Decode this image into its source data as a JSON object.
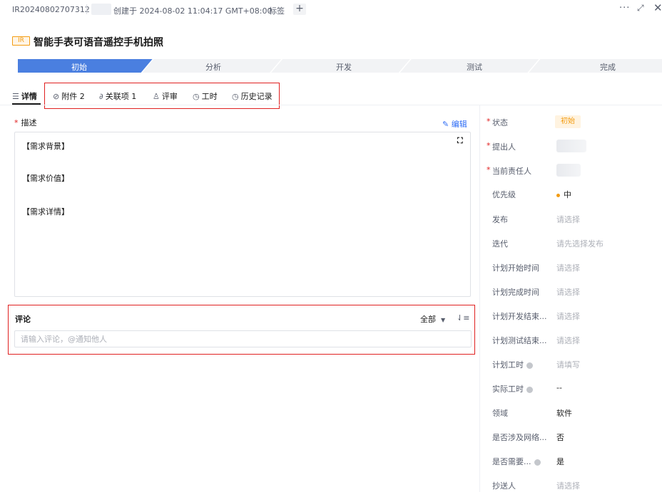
{
  "header": {
    "id": "IR20240802707312",
    "created_text": "创建于 2024-08-02 11:04:17 GMT+08:00",
    "tag_label": "标签",
    "add_label": "+",
    "more_label": "···",
    "expand_label": "⤢",
    "close_label": "✕"
  },
  "item": {
    "type_badge": "IR",
    "title": "智能手表可语音遥控手机拍照"
  },
  "workflow": {
    "steps": [
      "初始",
      "分析",
      "开发",
      "测试",
      "完成"
    ],
    "active_index": 0
  },
  "tabs": [
    {
      "label": "详情",
      "icon": "document-icon",
      "glyph": "☰"
    },
    {
      "label": "附件 2",
      "icon": "paperclip-icon",
      "glyph": "⊘"
    },
    {
      "label": "关联项 1",
      "icon": "link-icon",
      "glyph": "∂"
    },
    {
      "label": "评审",
      "icon": "stamp-icon",
      "glyph": "♙"
    },
    {
      "label": "工时",
      "icon": "clock-icon",
      "glyph": "◷"
    },
    {
      "label": "历史记录",
      "icon": "history-icon",
      "glyph": "◷"
    }
  ],
  "description": {
    "label": "描述",
    "required_mark": "*",
    "edit_label": "编辑",
    "fullscreen_glyph": "⛶",
    "lines": [
      "【需求背景】",
      "【需求价值】",
      "【需求详情】"
    ]
  },
  "comments": {
    "title": "评论",
    "filter_label": "全部",
    "placeholder": "请输入评论，@通知他人"
  },
  "properties": [
    {
      "label": "状态",
      "required": true,
      "value": "初始",
      "kind": "badge"
    },
    {
      "label": "提出人",
      "required": true,
      "value": "",
      "kind": "avatar"
    },
    {
      "label": "当前责任人",
      "required": true,
      "value": "",
      "kind": "avatar"
    },
    {
      "label": "优先级",
      "required": false,
      "value": "中",
      "kind": "priority"
    },
    {
      "label": "发布",
      "required": false,
      "value": "请选择",
      "kind": "placeholder"
    },
    {
      "label": "迭代",
      "required": false,
      "value": "请先选择发布",
      "kind": "placeholder"
    },
    {
      "label": "计划开始时间",
      "required": false,
      "value": "请选择",
      "kind": "placeholder"
    },
    {
      "label": "计划完成时间",
      "required": false,
      "value": "请选择",
      "kind": "placeholder"
    },
    {
      "label": "计划开发结束...",
      "required": false,
      "value": "请选择",
      "kind": "placeholder"
    },
    {
      "label": "计划测试结束...",
      "required": false,
      "value": "请选择",
      "kind": "placeholder"
    },
    {
      "label": "计划工时",
      "required": false,
      "value": "请填写",
      "kind": "placeholder",
      "help": true
    },
    {
      "label": "实际工时",
      "required": false,
      "value": "--",
      "kind": "text",
      "help": true
    },
    {
      "label": "领域",
      "required": false,
      "value": "软件",
      "kind": "text"
    },
    {
      "label": "是否涉及网络...",
      "required": false,
      "value": "否",
      "kind": "text"
    },
    {
      "label": "是否需要...",
      "required": false,
      "value": "是",
      "kind": "text",
      "help": true
    },
    {
      "label": "抄送人",
      "required": false,
      "value": "请选择",
      "kind": "placeholder"
    }
  ],
  "colors": {
    "accent": "#2f6df5",
    "step_active": "#4a7fe0",
    "step_inactive": "#f2f3f5",
    "warning": "#f39c12",
    "highlight": "#e02020"
  }
}
